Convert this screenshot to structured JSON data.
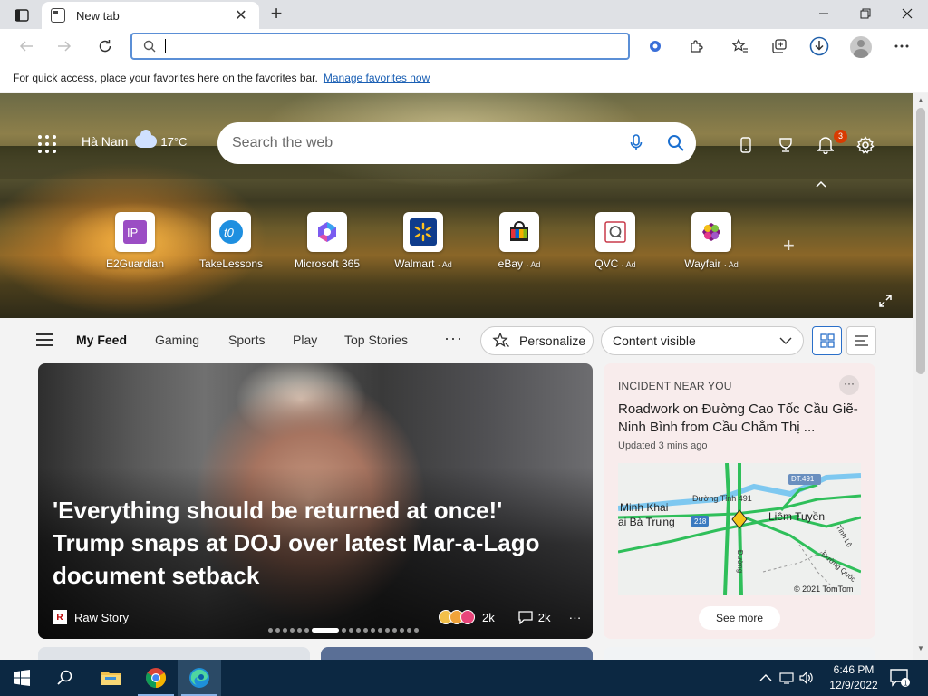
{
  "browser": {
    "tab_title": "New tab",
    "address_placeholder": ""
  },
  "favorites_bar": {
    "message": "For quick access, place your favorites here on the favorites bar.",
    "link": "Manage favorites now"
  },
  "hero": {
    "location": "Hà Nam",
    "temperature": "17°C",
    "search_placeholder": "Search the web",
    "notification_count": "3"
  },
  "quick_links": [
    {
      "label": "E2Guardian",
      "ad": ""
    },
    {
      "label": "TakeLessons",
      "ad": ""
    },
    {
      "label": "Microsoft 365",
      "ad": ""
    },
    {
      "label": "Walmart",
      "ad": "· Ad"
    },
    {
      "label": "eBay",
      "ad": "· Ad"
    },
    {
      "label": "QVC",
      "ad": "· Ad"
    },
    {
      "label": "Wayfair",
      "ad": "· Ad"
    }
  ],
  "feed_nav": {
    "items": [
      "My Feed",
      "Gaming",
      "Sports",
      "Play",
      "Top Stories"
    ],
    "more": "···",
    "personalize": "Personalize",
    "content_visibility": "Content visible"
  },
  "main_story": {
    "headline": "'Everything should be returned at once!' Trump snaps at DOJ over latest Mar-a-Lago document setback",
    "source": "Raw Story",
    "source_logo": "R",
    "reactions": "2k",
    "comments": "2k",
    "more": "···"
  },
  "incident_card": {
    "label": "INCIDENT NEAR YOU",
    "title": "Roadwork on Đường Cao Tốc Cầu Giẽ-Ninh Bình from Cầu Chằm Thị ...",
    "updated": "Updated 3 mins ago",
    "see_more": "See more",
    "more": "···",
    "map": {
      "labels": [
        "Minh Khai",
        "ai Bà Trưng",
        "Đường Tỉnh 491",
        "ĐT.491",
        "Liêm Tuyền",
        "Tỉnh Lộ",
        "218",
        "Đường Quốc",
        "Đường",
        "Đường Qu"
      ],
      "attribution": "© 2021 TomTom"
    }
  },
  "taskbar": {
    "time": "6:46 PM",
    "date": "12/9/2022",
    "notification_count": "1"
  }
}
